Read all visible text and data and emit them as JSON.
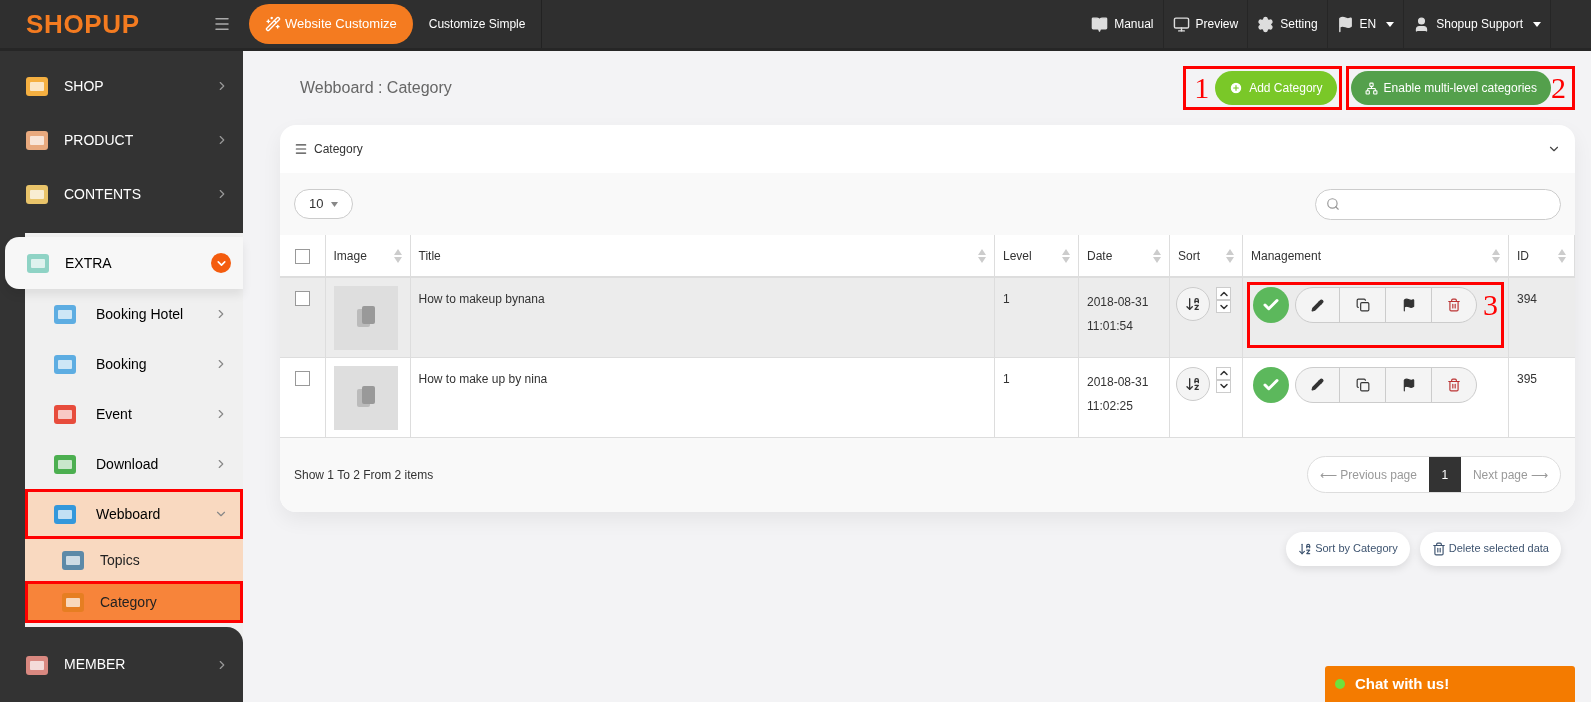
{
  "brand": {
    "logo": "SHOPUP"
  },
  "topbar": {
    "customize_button": "Website Customize",
    "simple_link": "Customize Simple",
    "menu": [
      {
        "label": "Manual",
        "dropdown": false
      },
      {
        "label": "Preview",
        "dropdown": false
      },
      {
        "label": "Setting",
        "dropdown": false
      },
      {
        "label": "EN",
        "dropdown": true
      },
      {
        "label": "Shopup Support",
        "dropdown": true
      }
    ]
  },
  "sidebar": {
    "top_items": [
      {
        "label": "SHOP"
      },
      {
        "label": "PRODUCT"
      },
      {
        "label": "CONTENTS"
      }
    ],
    "extra": {
      "label": "EXTRA",
      "expanded": true,
      "children": [
        {
          "label": "Booking Hotel",
          "expanded": false,
          "annotated": false
        },
        {
          "label": "Booking",
          "expanded": false,
          "annotated": false
        },
        {
          "label": "Event",
          "expanded": false,
          "annotated": false
        },
        {
          "label": "Download",
          "expanded": false,
          "annotated": false
        },
        {
          "label": "Webboard",
          "expanded": true,
          "annotated": true,
          "children": [
            {
              "label": "Topics",
              "selected": false,
              "annotated": false
            },
            {
              "label": "Category",
              "selected": true,
              "annotated": true
            }
          ]
        }
      ]
    },
    "bottom_items": [
      {
        "label": "MEMBER"
      }
    ]
  },
  "page": {
    "title": "Webboard : Category",
    "add_button": {
      "label": "Add Category",
      "annotation": "1"
    },
    "multilevel_button": {
      "label": "Enable multi-level categories",
      "annotation": "2"
    }
  },
  "card": {
    "title": "Category",
    "page_size": "10",
    "select_all_checked": false,
    "columns": [
      "Image",
      "Title",
      "Level",
      "Date",
      "Sort",
      "Management",
      "ID"
    ],
    "rows": [
      {
        "checked": false,
        "hovered": true,
        "title": "How to makeup bynana",
        "level": "1",
        "date": "2018-08-31",
        "time": "11:01:54",
        "active": true,
        "id": "394",
        "annotation": "3"
      },
      {
        "checked": false,
        "hovered": false,
        "title": "How to make up by nina",
        "level": "1",
        "date": "2018-08-31",
        "time": "11:02:25",
        "active": true,
        "id": "395"
      }
    ],
    "summary": "Show 1 To 2 From 2 items",
    "pagination": {
      "previous": "⟵ Previous page",
      "pages": [
        {
          "label": "1",
          "selected": true
        }
      ],
      "next": "Next page ⟶"
    }
  },
  "actions": [
    "Sort by Category",
    "Delete selected data"
  ],
  "chat": {
    "label": "Chat with us!",
    "online": true
  }
}
